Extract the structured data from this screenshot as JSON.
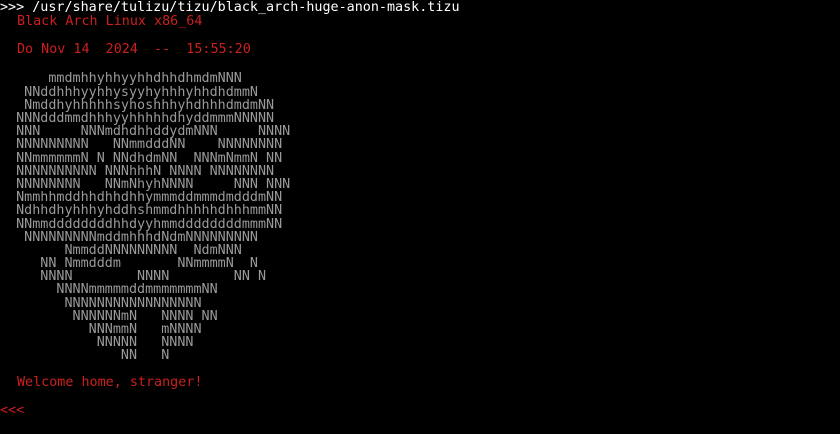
{
  "colors": {
    "background": "#000000",
    "prompt": "#ffffff",
    "accent_red": "#cc1f1f",
    "ascii_gray": "#9a9a9a"
  },
  "prompt_line": ">>> /usr/share/tulizu/tizu/black_arch-huge-anon-mask.tizu",
  "header": {
    "system": "Black Arch Linux x86_64",
    "datetime": "Do Nov 14  2024  --  15:55:20"
  },
  "ascii_art": [
    "      mmdmhhyhhyyhhdhhdhmdmNNN",
    "   NNddhhhyyhhysyyhyhhhyhhdhdmmN",
    "   NmddhyhhhhhsyhoshhhyhdhhhdmdmNN",
    "  NNNdddmmdhhhyyhhhhhdhyddmmmNNNNN",
    "  NNN     NNNmdhdhhddydmNNN     NNNN",
    "  NNNNNNNNN   NNmmdddNN    NNNNNNNN",
    "  NNmmmmmmN N NNdhdmNN  NNNmNmmN NN",
    "  NNNNNNNNNN NNNhhhN NNNN NNNNNNNN",
    "  NNNNNNNN   NNmNhyhNNNN     NNN NNN",
    "  NmmhhmddhhdhhdhhymmmddmmmdmdddmNN",
    "  NdhhdhyhhhyhddhshmmdhhhhhdhhhmmNN",
    "  NNmmddddddddhhdyyhmmddddddddmmmNN",
    "   NNNNNNNNNmddmhhhdNdmNNNNNNNNN",
    "        NmmddNNNNNNNNN  NdmNNN",
    "     NN Nmmdddm       NNmmmmN  N",
    "     NNNN        NNNN        NN N",
    "       NNNNmmmmmddmmmmmmmNN",
    "        NNNNNNNNNNNNNNNNN",
    "         NNNNNNmN   NNNN NN",
    "           NNNmmN   mNNNN",
    "            NNNNN   NNNN",
    "               NN   N"
  ],
  "welcome": "Welcome home, stranger!",
  "input_prompt": "<<<"
}
